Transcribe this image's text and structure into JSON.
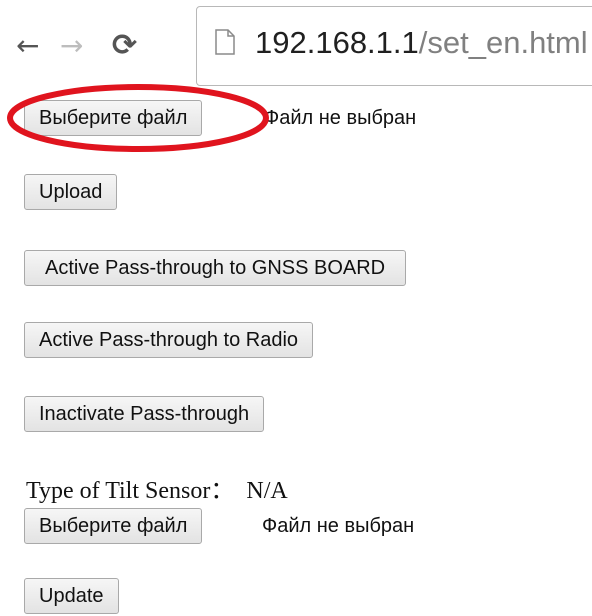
{
  "browser": {
    "url_host": "192.168.1.1",
    "url_path": "/set_en.html",
    "icons": [
      "back-arrow-icon",
      "forward-arrow-icon",
      "reload-icon",
      "page-icon"
    ]
  },
  "firmware_upload": {
    "choose_file_label": "Выберите файл",
    "file_status": "Файл не выбран",
    "upload_label": "Upload"
  },
  "passthrough": {
    "gnss_label": "Active Pass-through to GNSS BOARD",
    "radio_label": "Active Pass-through to Radio",
    "inactivate_label": "Inactivate Pass-through"
  },
  "tilt_sensor": {
    "label": "Type of Tilt Sensor：",
    "value": "N/A",
    "choose_file_label": "Выберите файл",
    "file_status": "Файл не выбран",
    "update_label": "Update"
  },
  "annotation": {
    "color": "#e0141e"
  }
}
